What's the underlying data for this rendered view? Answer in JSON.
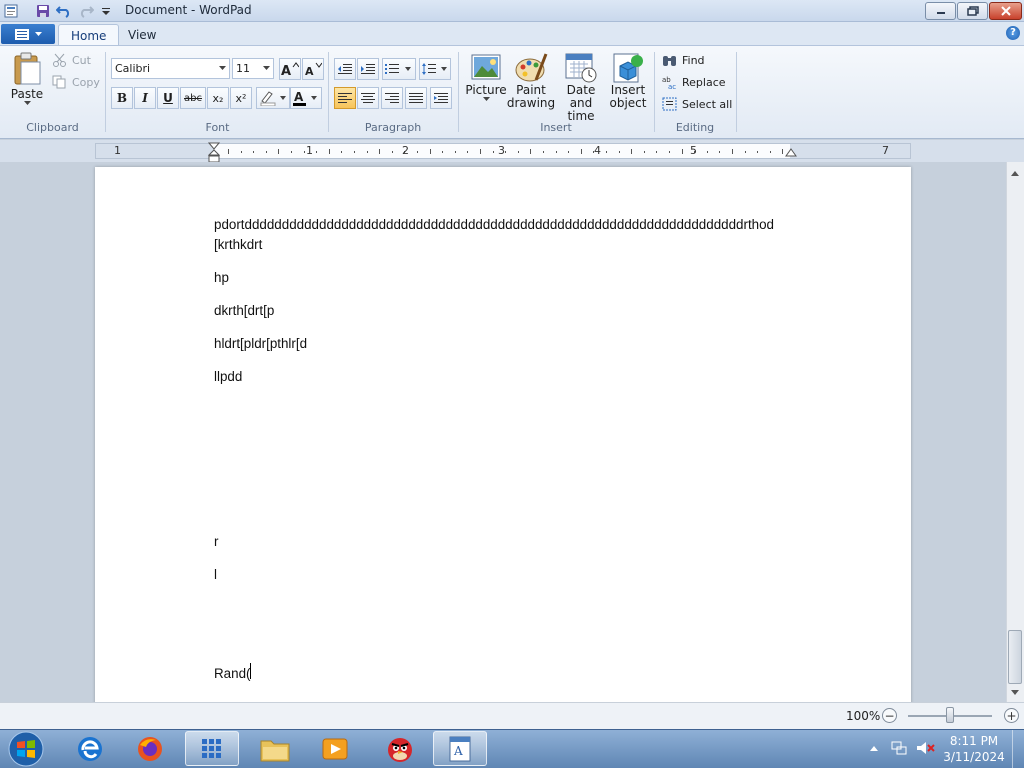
{
  "window": {
    "title": "Document - WordPad"
  },
  "tabs": [
    {
      "label": "Home"
    },
    {
      "label": "View"
    }
  ],
  "clipboard": {
    "paste": "Paste",
    "cut": "Cut",
    "copy": "Copy",
    "label": "Clipboard"
  },
  "font": {
    "family": "Calibri",
    "size": "11",
    "label": "Font",
    "bold": "B",
    "italic": "I",
    "underline": "U",
    "strike": "abc",
    "sub": "x₂",
    "sup": "x²"
  },
  "paragraph": {
    "label": "Paragraph"
  },
  "insert": {
    "picture": "Picture",
    "paint": [
      "Paint",
      "drawing"
    ],
    "datetime": [
      "Date and",
      "time"
    ],
    "object": [
      "Insert",
      "object"
    ],
    "label": "Insert"
  },
  "editing": {
    "find": "Find",
    "replace": "Replace",
    "select_all": "Select all",
    "label": "Editing"
  },
  "ruler": {
    "numbers": [
      "1",
      "1",
      "2",
      "3",
      "4",
      "5",
      "7"
    ]
  },
  "document": {
    "lines": [
      "pdortdddddddddddddddddddddddddddddddddddddddddddddddddddddddddddddddddddrthod",
      "[krthkdrt",
      "hp",
      "dkrth[drt[p",
      "hldrt[pldr[pthlr[d",
      "llpdd",
      "r",
      "l",
      "Rand("
    ]
  },
  "statusbar": {
    "zoom": "100%",
    "zoom_out": "−",
    "zoom_in": "+"
  },
  "taskbar": {
    "time": "8:11 PM",
    "date": "3/11/2024",
    "apps": [
      "start",
      "edge",
      "firefox",
      "apps",
      "file-explorer",
      "media-player",
      "angry-birds",
      "wordpad"
    ]
  }
}
